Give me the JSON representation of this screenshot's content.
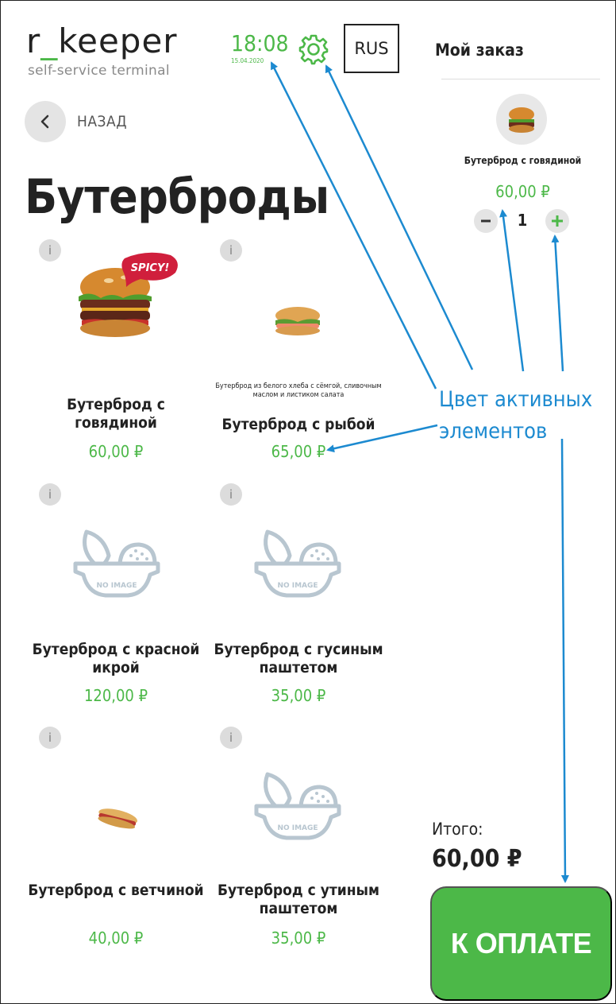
{
  "header": {
    "logo_main": "r_keeper",
    "logo_sub": "self-service terminal",
    "clock": "18:08",
    "date": "15.04.2020",
    "language": "RUS"
  },
  "nav": {
    "back_label": "НАЗАД"
  },
  "page_title": "Бутерброды",
  "products": [
    {
      "name": "Бутерброд с говядиной",
      "price": "60,00 ₽",
      "image": "burger-spicy",
      "badge": "SPICY!",
      "description": ""
    },
    {
      "name": "Бутерброд с рыбой",
      "price": "65,00 ₽",
      "image": "fish-sandwich",
      "badge": "",
      "description": "Бутерброд из белого хлеба с сёмгой, сливочным маслом и листиком салата"
    },
    {
      "name": "Бутерброд с красной икрой",
      "price": "120,00 ₽",
      "image": "no-image",
      "badge": "",
      "description": ""
    },
    {
      "name": "Бутерброд с гусиным паштетом",
      "price": "35,00 ₽",
      "image": "no-image",
      "badge": "",
      "description": ""
    },
    {
      "name": "Бутерброд с ветчиной",
      "price": "40,00 ₽",
      "image": "ham-sandwich",
      "badge": "",
      "description": ""
    },
    {
      "name": "Бутерброд с утиным паштетом",
      "price": "35,00 ₽",
      "image": "no-image",
      "badge": "",
      "description": ""
    }
  ],
  "info_icon_label": "i",
  "no_image_label": "NO IMAGE",
  "order": {
    "title": "Мой заказ",
    "items": [
      {
        "name": "Бутерброд с говядиной",
        "price": "60,00 ₽",
        "quantity": "1"
      }
    ],
    "total_label": "Итого:",
    "total_value": "60,00 ₽",
    "pay_label": "К ОПЛАТЕ"
  },
  "annotation": {
    "line1": "Цвет активных",
    "line2": "элементов"
  },
  "colors": {
    "accent": "#4cb848",
    "annotation": "#1c8ad0",
    "text": "#222222",
    "muted": "#e4e4e4"
  }
}
